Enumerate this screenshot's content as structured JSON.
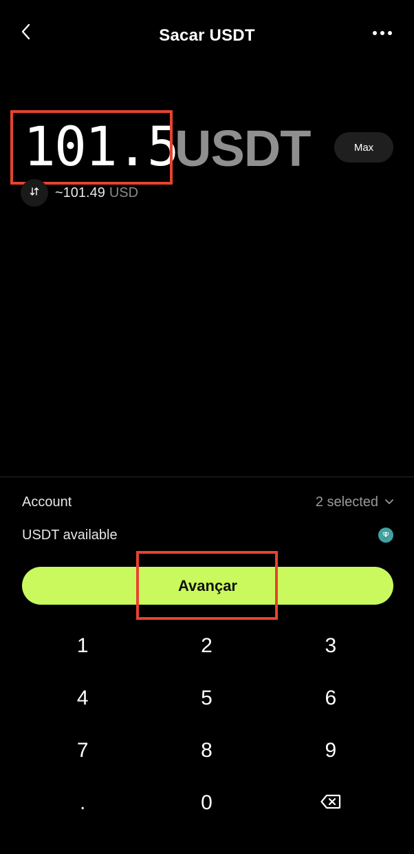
{
  "header": {
    "title": "Sacar USDT"
  },
  "amount": {
    "value": "101.5",
    "unit": "USDT",
    "max_label": "Max"
  },
  "conversion": {
    "value": "~101.49",
    "unit": "USD"
  },
  "details": {
    "account_label": "Account",
    "account_value": "2 selected",
    "available_label": "USDT available"
  },
  "cta": {
    "label": "Avançar"
  },
  "keypad": {
    "keys": [
      "1",
      "2",
      "3",
      "4",
      "5",
      "6",
      "7",
      "8",
      "9",
      ".",
      "0"
    ]
  },
  "colors": {
    "accent": "#c9f95c",
    "highlight": "#e8432d",
    "background": "#000000"
  }
}
